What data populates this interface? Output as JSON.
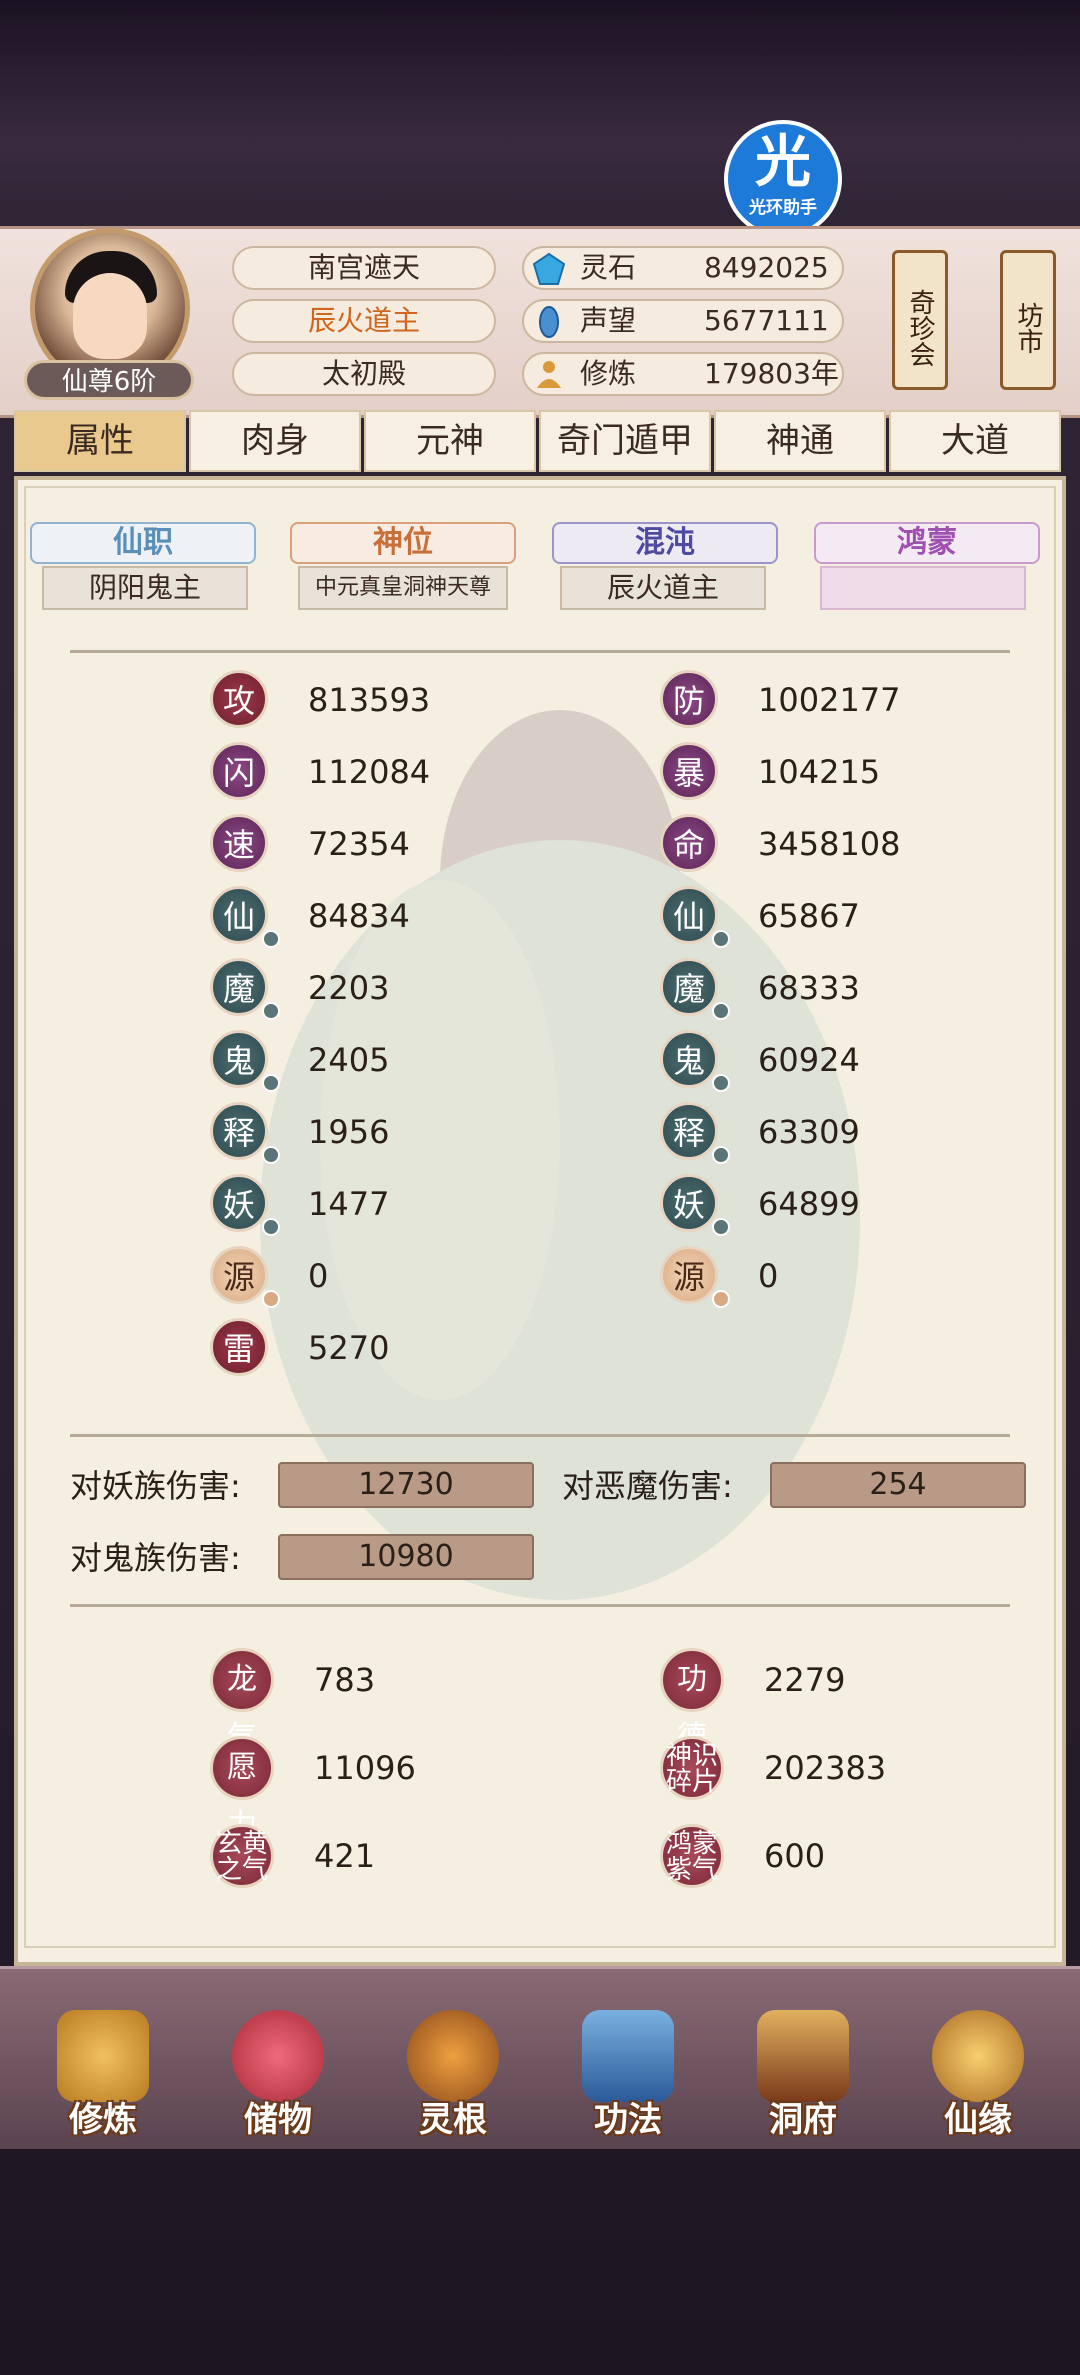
{
  "assistant": {
    "glyph": "光",
    "label": "光环助手"
  },
  "profile": {
    "rank": "仙尊6阶",
    "names": [
      "南宫遮天",
      "辰火道主",
      "太初殿"
    ]
  },
  "resources": [
    {
      "icon": "spirit-stone-icon",
      "label": "灵石",
      "value": "8492025"
    },
    {
      "icon": "reputation-icon",
      "label": "声望",
      "value": "5677111"
    },
    {
      "icon": "cultivation-icon",
      "label": "修炼",
      "value": "179803年"
    }
  ],
  "side_banners": {
    "treasure": "奇珍会",
    "market": "坊市"
  },
  "tabs": [
    "属性",
    "肉身",
    "元神",
    "奇门遁甲",
    "神通",
    "大道"
  ],
  "active_tab": "属性",
  "roles": [
    {
      "title": "仙职",
      "value": "阴阳鬼主",
      "color": "#5a8fb8"
    },
    {
      "title": "神位",
      "value": "中元真皇洞神天尊",
      "color": "#c8703a"
    },
    {
      "title": "混沌",
      "value": "辰火道主",
      "color": "#4d4aa0"
    },
    {
      "title": "鸿蒙",
      "value": "",
      "color": "#a050b0"
    }
  ],
  "stats_left": [
    {
      "char": "攻",
      "value": "813593"
    },
    {
      "char": "闪",
      "value": "112084"
    },
    {
      "char": "速",
      "value": "72354"
    },
    {
      "char": "仙",
      "value": "84834"
    },
    {
      "char": "魔",
      "value": "2203"
    },
    {
      "char": "鬼",
      "value": "2405"
    },
    {
      "char": "释",
      "value": "1956"
    },
    {
      "char": "妖",
      "value": "1477"
    },
    {
      "char": "源",
      "value": "0"
    },
    {
      "char": "雷",
      "value": "5270"
    }
  ],
  "stats_right": [
    {
      "char": "防",
      "value": "1002177"
    },
    {
      "char": "暴",
      "value": "104215"
    },
    {
      "char": "命",
      "value": "3458108"
    },
    {
      "char": "仙",
      "value": "65867"
    },
    {
      "char": "魔",
      "value": "68333"
    },
    {
      "char": "鬼",
      "value": "60924"
    },
    {
      "char": "释",
      "value": "63309"
    },
    {
      "char": "妖",
      "value": "64899"
    },
    {
      "char": "源",
      "value": "0"
    }
  ],
  "damage": [
    {
      "label": "对妖族伤害:",
      "value": "12730"
    },
    {
      "label": "对恶魔伤害:",
      "value": "254"
    },
    {
      "label": "对鬼族伤害:",
      "value": "10980"
    }
  ],
  "misc": [
    {
      "char": "龙气",
      "value": "783"
    },
    {
      "char": "功德",
      "value": "2279"
    },
    {
      "char": "愿力",
      "value": "11096"
    },
    {
      "char": "神识碎片",
      "value": "202383"
    },
    {
      "char": "玄黄之气",
      "value": "421"
    },
    {
      "char": "鸿蒙紫气",
      "value": "600"
    }
  ],
  "nav": [
    {
      "label": "修炼",
      "icon": "cultivate-icon",
      "color": "#d89a3a"
    },
    {
      "label": "储物",
      "icon": "storage-bag-icon",
      "color": "#d0445a"
    },
    {
      "label": "灵根",
      "icon": "spirit-root-icon",
      "color": "#b86a2a"
    },
    {
      "label": "功法",
      "icon": "technique-book-icon",
      "color": "#4a78b0"
    },
    {
      "label": "洞府",
      "icon": "cave-house-icon",
      "color": "#9a5a3a"
    },
    {
      "label": "仙缘",
      "icon": "fortune-gourd-icon",
      "color": "#d8a040"
    }
  ]
}
